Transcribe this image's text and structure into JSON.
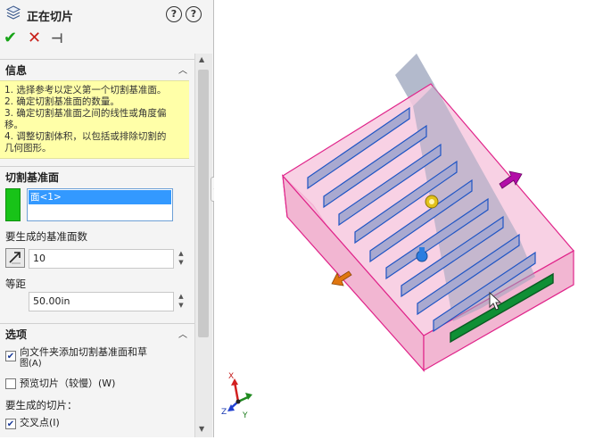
{
  "panel": {
    "title": "正在切片",
    "help_icon_1": "?",
    "help_icon_2": "?",
    "actions": {
      "ok": "✔",
      "cancel": "✕",
      "pin": "⊣"
    },
    "info_section": {
      "title": "信息",
      "lines": [
        "1. 选择参考以定义第一个切割基准面。",
        "2. 确定切割基准面的数量。",
        "3. 确定切割基准面之间的线性或角度偏",
        "移。",
        "4. 调整切割体积，以包括或排除切割的",
        "几何图形。"
      ]
    },
    "cut_plane_section": {
      "title": "切割基准面",
      "selected_item": "面<1>",
      "count_label": "要生成的基准面数",
      "count_value": "10",
      "distance_label": "等距",
      "distance_value": "50.00in"
    },
    "options_section": {
      "title": "选项",
      "add_to_folder_label": "向文件夹添加切割基准面和草",
      "add_to_folder_label_2": "图(A)",
      "add_to_folder_checked": "✔",
      "preview_label": "预览切片（较慢）(W)",
      "preview_checked": "",
      "slices_label": "要生成的切片：",
      "intersection_label": "交叉点(I)",
      "intersection_checked": "✔"
    }
  },
  "viewport": {
    "triad": {
      "x": "X",
      "y": "Y",
      "z": "Z"
    },
    "colors": {
      "box_fill": "#f4b8d4",
      "box_edge": "#e0248a",
      "slice_fill": "#a9a9d0",
      "slice_edge": "#1f55c4",
      "cut_plane": "#9aa3bb",
      "green_slice": "#0f8f35",
      "arrow_magenta": "#b30da8",
      "arrow_orange": "#e0760f"
    }
  }
}
